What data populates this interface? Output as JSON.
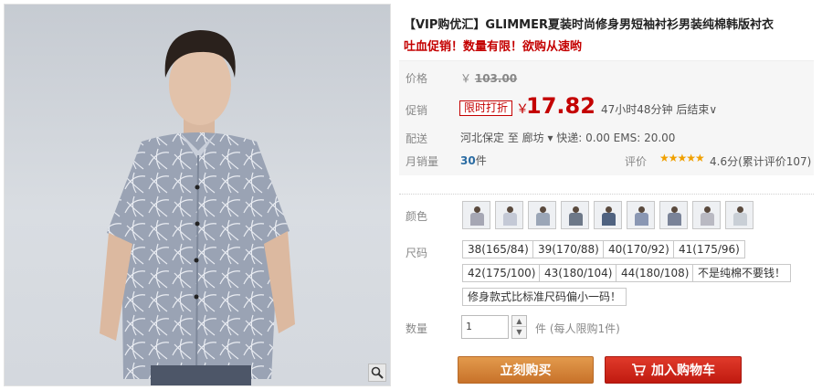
{
  "product": {
    "title": "【VIP购优汇】GLIMMER夏装时尚修身男短袖衬衫男装纯棉韩版衬衣",
    "subtitle": "吐血促销！数量有限！欲购从速哟"
  },
  "price": {
    "label": "价格",
    "currency": "￥",
    "original": "103.00"
  },
  "promo": {
    "label": "促销",
    "tag": "限时打折",
    "currency": "￥",
    "price": "17.82",
    "countdown": "47小时48分钟 后结束∨"
  },
  "shipping": {
    "label": "配送",
    "text": "河北保定  至  廊坊 ▾  快递: 0.00 EMS: 20.00"
  },
  "sales": {
    "label": "月销量",
    "count": "30",
    "unit": "件",
    "rating_label": "评价",
    "stars": "★★★★★",
    "rating_text": "4.6分(累计评价107)"
  },
  "options": {
    "color_label": "颜色",
    "swatch_colors": [
      "#a6a7b4",
      "#c4c9d6",
      "#9ba6b7",
      "#6d7888",
      "#4f6280",
      "#8a97b3",
      "#7a8398",
      "#b9b9c2",
      "#c9cfd6"
    ],
    "size_label": "尺码",
    "sizes": [
      "38(165/84)",
      "39(170/88)",
      "40(170/92)",
      "41(175/96)",
      "42(175/100)",
      "43(180/104)",
      "44(180/108)",
      "不是纯棉不要钱！",
      "修身款式比标准尺码偏小一码！"
    ]
  },
  "quantity": {
    "label": "数量",
    "value": "1",
    "note": "件 (每人限购1件)"
  },
  "buttons": {
    "buy": "立刻购买",
    "cart": "加入购物车"
  },
  "colors": {
    "accent_red": "#c40000",
    "buy_button": "#d27f36",
    "cart_button": "#d12a1c",
    "stars": "#f0a000"
  }
}
